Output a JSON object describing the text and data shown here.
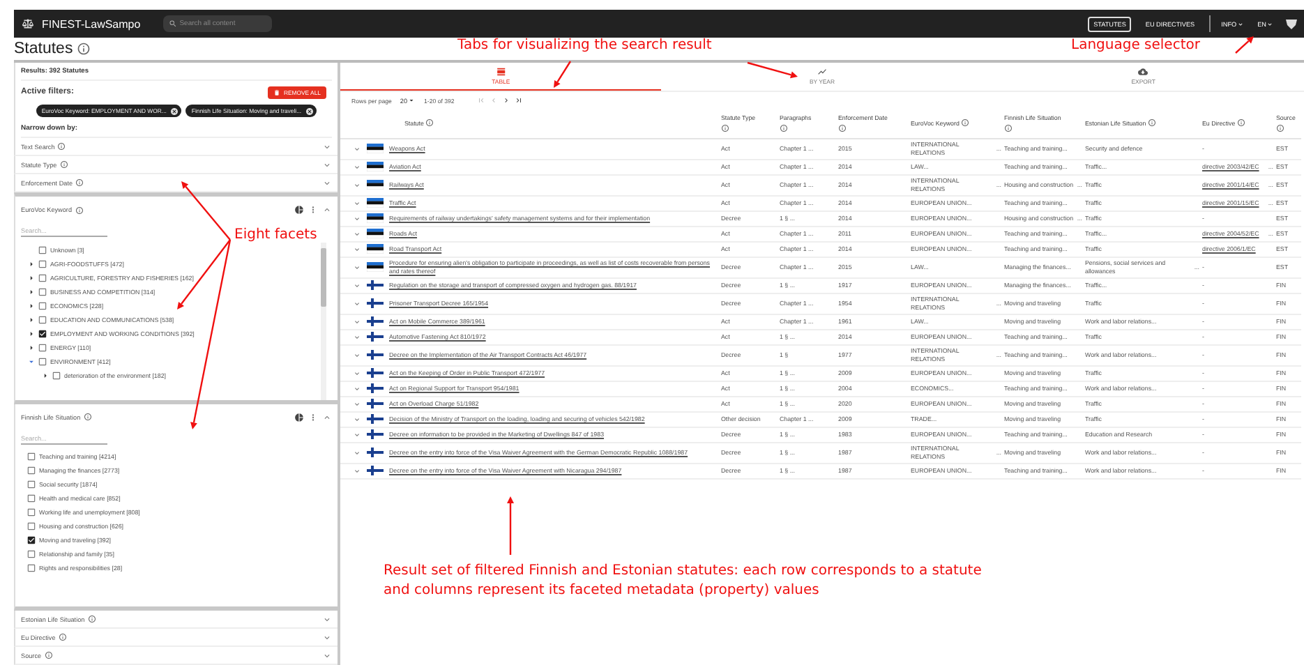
{
  "app_bar": {
    "title": "FINEST-LawSampo",
    "search": {
      "placeholder": "Search all content"
    },
    "nav": [
      {
        "label": "STATUTES",
        "selected": true
      },
      {
        "label": "EU DIRECTIVES",
        "selected": false
      }
    ],
    "menus": [
      {
        "label": "INFO"
      },
      {
        "label": "EN"
      }
    ]
  },
  "page_title": "Statutes",
  "results": "Results: 392 Statutes",
  "active_filters": {
    "title": "Active filters:",
    "remove_all": "REMOVE ALL",
    "chips": [
      "EuroVoc Keyword: EMPLOYMENT AND WOR...",
      "Finnish Life Situation: Moving and traveli..."
    ]
  },
  "narrow_title": "Narrow down by:",
  "facets": [
    {
      "label": "Text Search",
      "expanded": false
    },
    {
      "label": "Statute Type",
      "expanded": false
    },
    {
      "label": "Enforcement Date",
      "expanded": false
    },
    {
      "label": "EuroVoc Keyword",
      "expanded": true,
      "kind": "tree",
      "search": {
        "placeholder": "Search..."
      },
      "items": [
        {
          "label": "Unknown [3]",
          "checked": false
        },
        {
          "label": "AGRI-FOODSTUFFS [472]",
          "checked": false,
          "expanded": false
        },
        {
          "label": "AGRICULTURE, FORESTRY AND FISHERIES [162]",
          "checked": false,
          "expanded": false
        },
        {
          "label": "BUSINESS AND COMPETITION [314]",
          "checked": false,
          "expanded": false
        },
        {
          "label": "ECONOMICS [228]",
          "checked": false,
          "expanded": false
        },
        {
          "label": "EDUCATION AND COMMUNICATIONS [538]",
          "checked": false,
          "expanded": false
        },
        {
          "label": "EMPLOYMENT AND WORKING CONDITIONS [392]",
          "checked": true,
          "expanded": false
        },
        {
          "label": "ENERGY [110]",
          "checked": false,
          "expanded": false
        },
        {
          "label": "ENVIRONMENT [412]",
          "checked": false,
          "expanded": true,
          "children": [
            {
              "label": "deterioration of the environment [182]",
              "checked": false,
              "expanded": false
            }
          ]
        }
      ]
    },
    {
      "label": "Finnish Life Situation",
      "expanded": true,
      "kind": "list",
      "search": {
        "placeholder": "Search..."
      },
      "items": [
        {
          "label": "Teaching and training [4214]",
          "checked": false
        },
        {
          "label": "Managing the finances [2773]",
          "checked": false
        },
        {
          "label": "Social security [1874]",
          "checked": false
        },
        {
          "label": "Health and medical care [852]",
          "checked": false
        },
        {
          "label": "Working life and unemployment [808]",
          "checked": false
        },
        {
          "label": "Housing and construction [626]",
          "checked": false
        },
        {
          "label": "Moving and traveling [392]",
          "checked": true
        },
        {
          "label": "Relationship and family [35]",
          "checked": false
        },
        {
          "label": "Rights and responsibilities [28]",
          "checked": false
        }
      ]
    },
    {
      "label": "Estonian Life Situation",
      "expanded": false
    },
    {
      "label": "Eu Directive",
      "expanded": false
    },
    {
      "label": "Source",
      "expanded": false
    }
  ],
  "tabs": [
    {
      "label": "TABLE",
      "kind": "table",
      "selected": true
    },
    {
      "label": "BY YEAR",
      "kind": "chart",
      "selected": false
    },
    {
      "label": "EXPORT",
      "kind": "export",
      "selected": false
    }
  ],
  "pagination": {
    "rows_label": "Rows per page",
    "rows_value": "20",
    "range": "1-20 of 392"
  },
  "table": {
    "columns": [
      "Statute",
      "Statute Type",
      "Paragraphs",
      "Enforcement Date",
      "EuroVoc Keyword",
      "Finnish Life Situation",
      "Estonian Life Situation",
      "Eu Directive",
      "Source"
    ],
    "rows": [
      {
        "kind": "est",
        "statute": "Weapons Act",
        "type": "Act",
        "paragraphs": "Chapter 1 ...",
        "date": "2015",
        "keyword": {
          "text": "INTERNATIONAL RELATIONS",
          "more": "..."
        },
        "fi_situation": "Teaching and training...",
        "ee_situation": "Security and defence",
        "directive": "-",
        "source": "EST"
      },
      {
        "kind": "est",
        "statute": "Aviation Act",
        "type": "Act",
        "paragraphs": "Chapter 1 ...",
        "date": "2014",
        "keyword": "LAW...",
        "fi_situation": "Teaching and training...",
        "ee_situation": "Traffic...",
        "directive": {
          "text": "directive 2003/42/EC",
          "more": "..."
        },
        "source": "EST"
      },
      {
        "kind": "est",
        "statute": "Railways Act",
        "type": "Act",
        "paragraphs": "Chapter 1 ...",
        "date": "2014",
        "keyword": {
          "text": "INTERNATIONAL RELATIONS",
          "more": "..."
        },
        "fi_situation": {
          "text": "Housing and construction",
          "more": "..."
        },
        "ee_situation": "Traffic",
        "directive": {
          "text": "directive 2001/14/EC",
          "more": "..."
        },
        "source": "EST"
      },
      {
        "kind": "est",
        "statute": "Traffic Act",
        "type": "Act",
        "paragraphs": "Chapter 1 ...",
        "date": "2014",
        "keyword": "EUROPEAN UNION...",
        "fi_situation": "Teaching and training...",
        "ee_situation": "Traffic",
        "directive": {
          "text": "directive 2001/15/EC",
          "more": "..."
        },
        "source": "EST"
      },
      {
        "kind": "est",
        "statute": "Requirements of railway undertakings' safety management systems and for their implementation",
        "type": "Decree",
        "paragraphs": "1 § ...",
        "date": "2014",
        "keyword": "EUROPEAN UNION...",
        "fi_situation": {
          "text": "Housing and construction",
          "more": "..."
        },
        "ee_situation": "Traffic",
        "directive": "-",
        "source": "EST"
      },
      {
        "kind": "est",
        "statute": "Roads Act",
        "type": "Act",
        "paragraphs": "Chapter 1 ...",
        "date": "2011",
        "keyword": "EUROPEAN UNION...",
        "fi_situation": "Teaching and training...",
        "ee_situation": "Traffic...",
        "directive": {
          "text": "directive 2004/52/EC",
          "more": "..."
        },
        "source": "EST"
      },
      {
        "kind": "est",
        "statute": "Road Transport Act",
        "type": "Act",
        "paragraphs": "Chapter 1 ...",
        "date": "2014",
        "keyword": "EUROPEAN UNION...",
        "fi_situation": "Teaching and training...",
        "ee_situation": "Traffic",
        "directive": {
          "text": "directive 2006/1/EC"
        },
        "source": "EST"
      },
      {
        "kind": "est",
        "statute": "Procedure for ensuring alien's obligation to participate in proceedings, as well as list of costs recoverable from persons and rates thereof",
        "type": "Decree",
        "paragraphs": "Chapter 1 ...",
        "date": "2015",
        "keyword": "LAW...",
        "fi_situation": "Managing the finances...",
        "ee_situation": {
          "text": "Pensions, social services and allowances",
          "more": "..."
        },
        "directive": "-",
        "source": "EST"
      },
      {
        "kind": "fin",
        "statute": "Regulation on the storage and transport of compressed oxygen and hydrogen gas. 88/1917",
        "type": "Decree",
        "paragraphs": "1 § ...",
        "date": "1917",
        "keyword": "EUROPEAN UNION...",
        "fi_situation": "Managing the finances...",
        "ee_situation": "Traffic...",
        "directive": "-",
        "source": "FIN"
      },
      {
        "kind": "fin",
        "statute": "Prisoner Transport Decree 165/1954",
        "type": "Decree",
        "paragraphs": "Chapter 1 ...",
        "date": "1954",
        "keyword": {
          "text": "INTERNATIONAL RELATIONS",
          "more": "..."
        },
        "fi_situation": "Moving and traveling",
        "ee_situation": "Traffic",
        "directive": "-",
        "source": "FIN"
      },
      {
        "kind": "fin",
        "statute": "Act on Mobile Commerce 389/1961",
        "type": "Act",
        "paragraphs": "Chapter 1 ...",
        "date": "1961",
        "keyword": "LAW...",
        "fi_situation": "Moving and traveling",
        "ee_situation": "Work and labor relations...",
        "directive": "-",
        "source": "FIN"
      },
      {
        "kind": "fin",
        "statute": "Automotive Fastening Act 810/1972",
        "type": "Act",
        "paragraphs": "1 § ...",
        "date": "2014",
        "keyword": "EUROPEAN UNION...",
        "fi_situation": "Teaching and training...",
        "ee_situation": "Traffic",
        "directive": "-",
        "source": "FIN"
      },
      {
        "kind": "fin",
        "statute": "Decree on the Implementation of the Air Transport Contracts Act 46/1977",
        "type": "Decree",
        "paragraphs": "1 §",
        "date": "1977",
        "keyword": {
          "text": "INTERNATIONAL RELATIONS",
          "more": "..."
        },
        "fi_situation": "Teaching and training...",
        "ee_situation": "Work and labor relations...",
        "directive": "-",
        "source": "FIN"
      },
      {
        "kind": "fin",
        "statute": "Act on the Keeping of Order in Public Transport 472/1977",
        "type": "Act",
        "paragraphs": "1 § ...",
        "date": "2009",
        "keyword": "EUROPEAN UNION...",
        "fi_situation": "Moving and traveling",
        "ee_situation": "Traffic",
        "directive": "-",
        "source": "FIN"
      },
      {
        "kind": "fin",
        "statute": "Act on Regional Support for Transport 954/1981",
        "type": "Act",
        "paragraphs": "1 § ...",
        "date": "2004",
        "keyword": "ECONOMICS...",
        "fi_situation": "Teaching and training...",
        "ee_situation": "Work and labor relations...",
        "directive": "-",
        "source": "FIN"
      },
      {
        "kind": "fin",
        "statute": "Act on Overload Charge 51/1982",
        "type": "Act",
        "paragraphs": "1 § ...",
        "date": "2020",
        "keyword": "EUROPEAN UNION...",
        "fi_situation": "Moving and traveling",
        "ee_situation": "Traffic",
        "directive": "-",
        "source": "FIN"
      },
      {
        "kind": "fin",
        "statute": "Decision of the Ministry of Transport on the loading, loading and securing of vehicles 542/1982",
        "type": "Other decision",
        "paragraphs": "Chapter 1 ...",
        "date": "2009",
        "keyword": "TRADE...",
        "fi_situation": "Moving and traveling",
        "ee_situation": "Traffic",
        "directive": "-",
        "source": "FIN"
      },
      {
        "kind": "fin",
        "statute": "Decree on information to be provided in the Marketing of Dwellings 847 of 1983",
        "type": "Decree",
        "paragraphs": "1 § ...",
        "date": "1983",
        "keyword": "EUROPEAN UNION...",
        "fi_situation": "Teaching and training...",
        "ee_situation": "Education and Research",
        "directive": "-",
        "source": "FIN"
      },
      {
        "kind": "fin",
        "statute": "Decree on the entry into force of the Visa Waiver Agreement with the German Democratic Republic 1088/1987",
        "type": "Decree",
        "paragraphs": "1 § ...",
        "date": "1987",
        "keyword": {
          "text": "INTERNATIONAL RELATIONS",
          "more": "..."
        },
        "fi_situation": "Moving and traveling",
        "ee_situation": "Work and labor relations...",
        "directive": "-",
        "source": "FIN"
      },
      {
        "kind": "fin",
        "statute": "Decree on the entry into force of the Visa Waiver Agreement with Nicaragua 294/1987",
        "type": "Decree",
        "paragraphs": "1 § ...",
        "date": "1987",
        "keyword": "EUROPEAN UNION...",
        "fi_situation": "Teaching and training...",
        "ee_situation": "Work and labor relations...",
        "directive": "-",
        "source": "FIN"
      }
    ]
  },
  "annotations": [
    {
      "text": "Tabs for visualizing the search result"
    },
    {
      "text": "Language selector"
    },
    {
      "text": "Eight facets"
    },
    {
      "text": "Result set of filtered  Finnish and Estonian statutes: each row corresponds  to a statute\nand columns represent  its faceted  metadata (property) values"
    }
  ]
}
